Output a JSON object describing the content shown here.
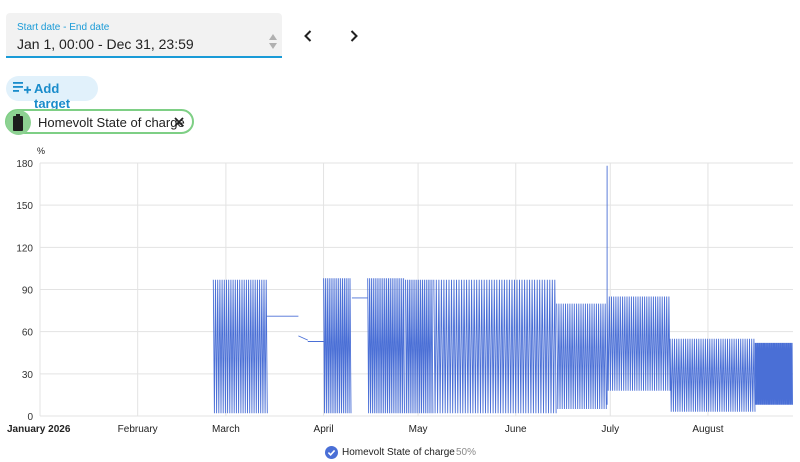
{
  "date_range": {
    "label": "Start date - End date",
    "value": "Jan 1, 00:00 - Dec 31, 23:59"
  },
  "nav": {
    "prev_icon": "chevron-left-icon",
    "next_icon": "chevron-right-icon"
  },
  "add_target": {
    "label": "Add target",
    "icon": "playlist-plus-icon"
  },
  "target_chip": {
    "label": "Homevolt State of charge",
    "icon": "battery-icon",
    "remove_icon": "close-icon"
  },
  "colors": {
    "accent": "#1a9bd7",
    "chip_border": "#7ecf85",
    "series_line": "#4a6fd6"
  },
  "chart_data": {
    "type": "line",
    "title": "",
    "ylabel": "%",
    "xlabel": "",
    "ylim": [
      0,
      180
    ],
    "yticks": [
      0,
      30,
      60,
      90,
      120,
      150,
      180
    ],
    "xlim": [
      "2026-01-01",
      "2026-08-28"
    ],
    "xticks": [
      {
        "date": "2026-01-01",
        "label": "January 2026",
        "bold": true
      },
      {
        "date": "2026-02-01",
        "label": "February"
      },
      {
        "date": "2026-03-01",
        "label": "March"
      },
      {
        "date": "2026-04-01",
        "label": "April"
      },
      {
        "date": "2026-05-01",
        "label": "May"
      },
      {
        "date": "2026-06-01",
        "label": "June"
      },
      {
        "date": "2026-07-01",
        "label": "July"
      },
      {
        "date": "2026-08-01",
        "label": "August"
      }
    ],
    "grid": true,
    "series": [
      {
        "name": "Homevolt State of charge",
        "legend_percent": "50%",
        "color": "#4a6fd6",
        "segments": [
          {
            "start": "2026-02-25",
            "end": "2026-03-14",
            "period_days": 0.7,
            "high": 97,
            "low": 2
          },
          {
            "start": "2026-03-14",
            "end": "2026-03-24",
            "period_days": 0,
            "high": 71,
            "low": 71
          },
          {
            "start": "2026-03-24",
            "end": "2026-03-27",
            "period_days": 0,
            "high": 57,
            "low": 54
          },
          {
            "start": "2026-03-27",
            "end": "2026-04-01",
            "period_days": 0,
            "high": 53,
            "low": 53
          },
          {
            "start": "2026-04-01",
            "end": "2026-04-10",
            "period_days": 0.6,
            "high": 98,
            "low": 2
          },
          {
            "start": "2026-04-10",
            "end": "2026-04-15",
            "period_days": 0,
            "high": 84,
            "low": 84
          },
          {
            "start": "2026-04-15",
            "end": "2026-04-27",
            "period_days": 0.6,
            "high": 98,
            "low": 2
          },
          {
            "start": "2026-04-27",
            "end": "2026-05-06",
            "period_days": 0.6,
            "high": 97,
            "low": 2
          },
          {
            "start": "2026-05-06",
            "end": "2026-06-14",
            "period_days": 0.8,
            "high": 97,
            "low": 2
          },
          {
            "start": "2026-06-14",
            "end": "2026-06-30",
            "period_days": 0.7,
            "high": 80,
            "low": 5
          },
          {
            "start": "2026-06-30",
            "end": "2026-06-30",
            "period_days": 0,
            "high": 178,
            "low": 8
          },
          {
            "start": "2026-06-30",
            "end": "2026-07-20",
            "period_days": 0.7,
            "high": 85,
            "low": 18
          },
          {
            "start": "2026-07-20",
            "end": "2026-08-16",
            "period_days": 0.7,
            "high": 55,
            "low": 3
          },
          {
            "start": "2026-08-16",
            "end": "2026-08-28",
            "period_days": 0.3,
            "high": 52,
            "low": 8
          }
        ]
      }
    ],
    "legend_position": "bottom-center"
  }
}
